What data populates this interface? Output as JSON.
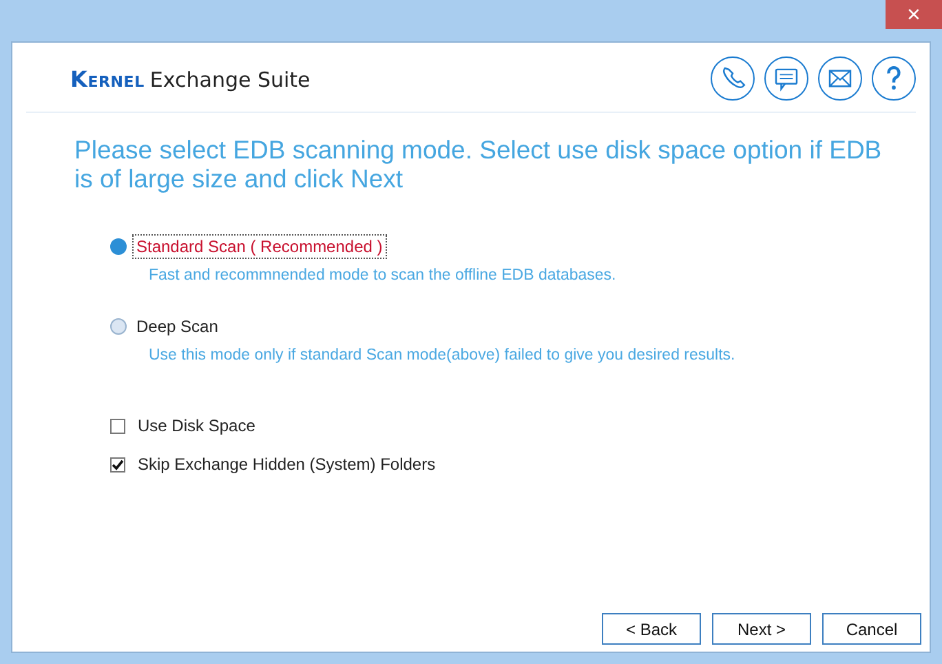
{
  "window": {
    "close_glyph": "×"
  },
  "header": {
    "logo_brand": "Kernel",
    "logo_product": "Exchange Suite"
  },
  "heading": "Please select EDB scanning mode. Select use disk space option if EDB is of large size and click Next",
  "scan_modes": [
    {
      "label": "Standard Scan ( Recommended )",
      "description": "Fast and recommnended mode to scan the offline EDB databases.",
      "selected": true
    },
    {
      "label": "Deep Scan",
      "description": "Use this mode only if standard Scan mode(above) failed to give you desired results.",
      "selected": false
    }
  ],
  "options": [
    {
      "label": "Use Disk Space",
      "checked": false
    },
    {
      "label": "Skip Exchange Hidden (System) Folders",
      "checked": true
    }
  ],
  "buttons": [
    "< Back",
    "Next >",
    "Cancel"
  ]
}
